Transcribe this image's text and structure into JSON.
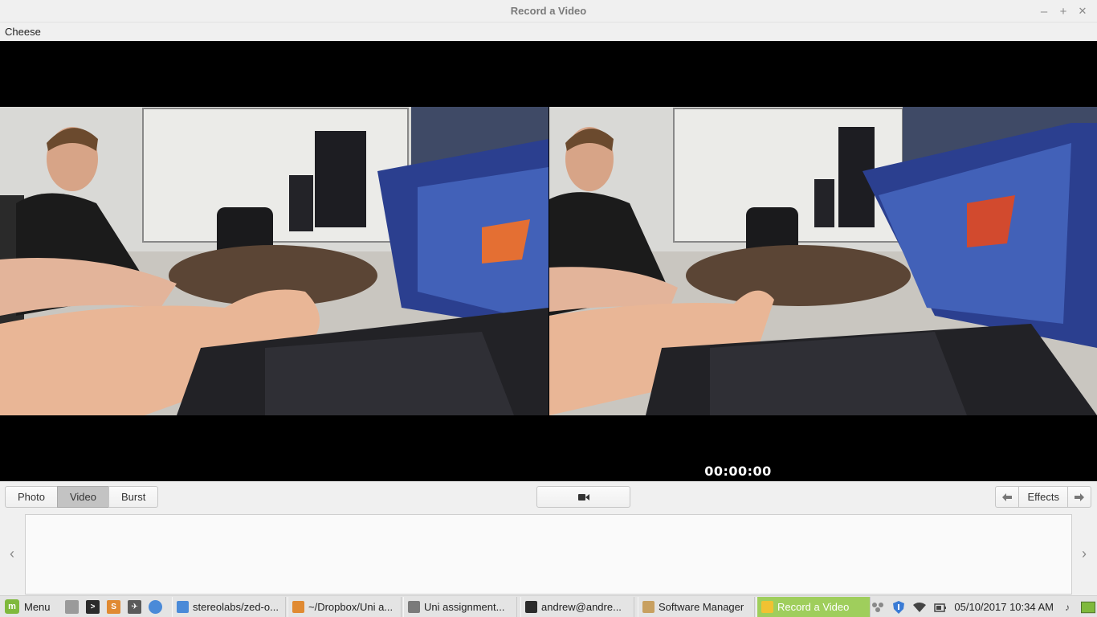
{
  "window": {
    "title": "Record a Video",
    "controls": {
      "minimize": "–",
      "maximize": "+",
      "close": "✕"
    }
  },
  "menubar": {
    "app_menu": "Cheese"
  },
  "viewfinder": {
    "timer": "00:00:00",
    "left_feed_icon": "camera-feed-scene",
    "right_feed_icon": "camera-feed-scene"
  },
  "toolbar": {
    "modes": [
      {
        "label": "Photo",
        "active": false
      },
      {
        "label": "Video",
        "active": true
      },
      {
        "label": "Burst",
        "active": false
      }
    ],
    "record_icon": "video-camera-icon",
    "effects": {
      "prev_icon": "arrow-left-icon",
      "label": "Effects",
      "next_icon": "arrow-right-icon"
    }
  },
  "thumbnails": {
    "prev": "‹",
    "next": "›"
  },
  "taskbar": {
    "menu_label": "Menu",
    "launchers": [
      "show-desktop-icon",
      "terminal-icon",
      "sublime-text-icon",
      "airplane-app-icon",
      "chromium-icon"
    ],
    "tasks": [
      {
        "label": "stereolabs/zed-o...",
        "icon": "chromium-icon",
        "color": "#4a8ad8",
        "active": false
      },
      {
        "label": "~/Dropbox/Uni a...",
        "icon": "sublime-text-icon",
        "color": "#e08a32",
        "active": false
      },
      {
        "label": "Uni assignment...",
        "icon": "document-viewer-icon",
        "color": "#7a7a7a",
        "active": false
      },
      {
        "label": "andrew@andre...",
        "icon": "terminal-icon",
        "color": "#2b2b2b",
        "active": false
      },
      {
        "label": "Software Manager",
        "icon": "software-manager-icon",
        "color": "#c8a060",
        "active": false
      },
      {
        "label": "Record a Video",
        "icon": "cheese-icon",
        "color": "#f1c232",
        "active": true
      }
    ],
    "tray": [
      "network-devices-icon",
      "shield-icon",
      "wifi-icon",
      "battery-icon"
    ],
    "clock": "05/10/2017 10:34 AM",
    "tray_end": [
      "music-note-icon",
      "workspace-icon"
    ]
  },
  "colors": {
    "accent": "#9fce5c",
    "panel": "#f0f0f0",
    "active_mode": "#c3c3c3"
  }
}
